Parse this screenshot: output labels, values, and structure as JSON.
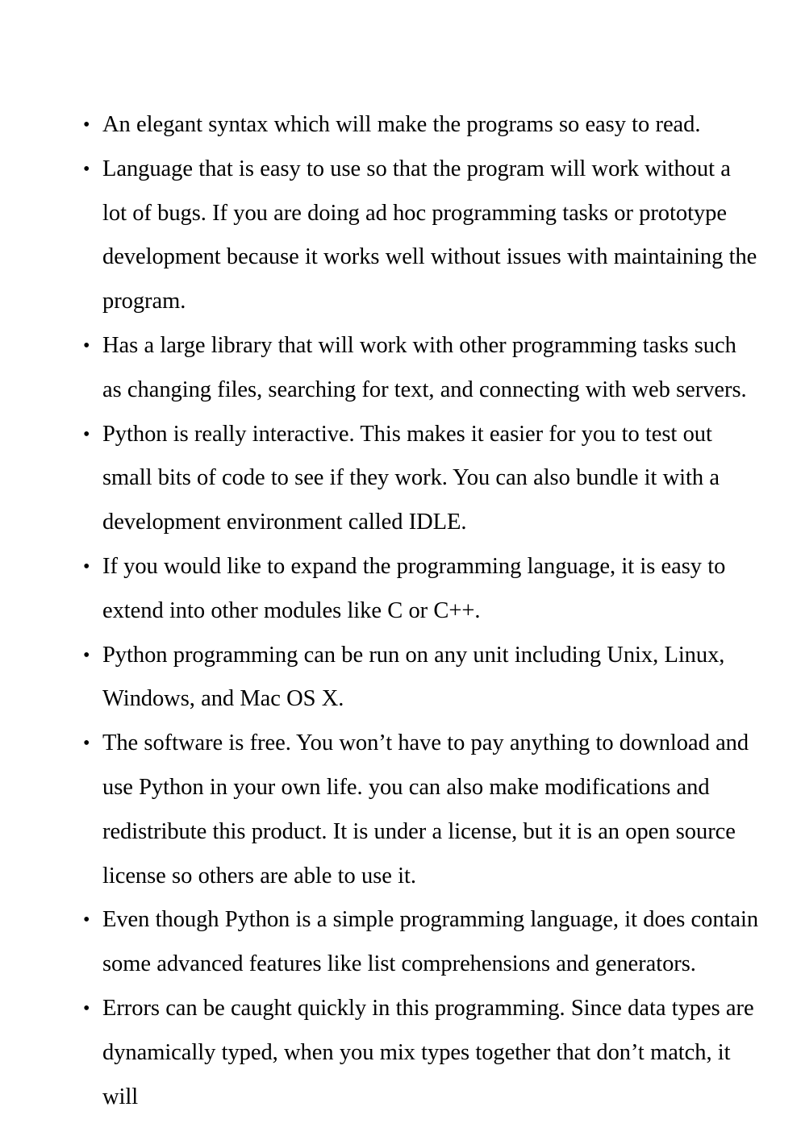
{
  "document": {
    "background_color": "#ffffff",
    "text_color": "#000000",
    "bullet_glyph": "•",
    "list": {
      "items": [
        {
          "text": "An elegant syntax which will make the programs so easy to read."
        },
        {
          "text": "Language that is easy to use so that the program will work without a lot of bugs. If you are doing ad hoc programming tasks or prototype development because it works well without issues with maintaining the program."
        },
        {
          "text": "Has a large library that will work with other programming tasks such as changing files, searching for text, and connecting with web servers."
        },
        {
          "text": "Python is really interactive. This makes it easier for you to test out small bits of code to see if they work. You can also bundle it with a development environment called IDLE."
        },
        {
          "text": "If you would like to expand the programming language, it is easy to extend into other modules like C or C++."
        },
        {
          "text": "Python programming can be run on any unit including Unix, Linux, Windows, and Mac OS X."
        },
        {
          "text": "The software is free. You won’t have to pay anything to download and use Python in your own life. you can also make modifications and redistribute this product. It is under a license, but it is an open source license so others are able to use it."
        },
        {
          "text": "Even though Python is a simple programming language, it does contain some advanced features like list comprehensions and generators."
        },
        {
          "text": "Errors can be caught quickly in this programming. Since data types are dynamically typed, when you mix types together that don’t match, it will"
        }
      ]
    }
  }
}
